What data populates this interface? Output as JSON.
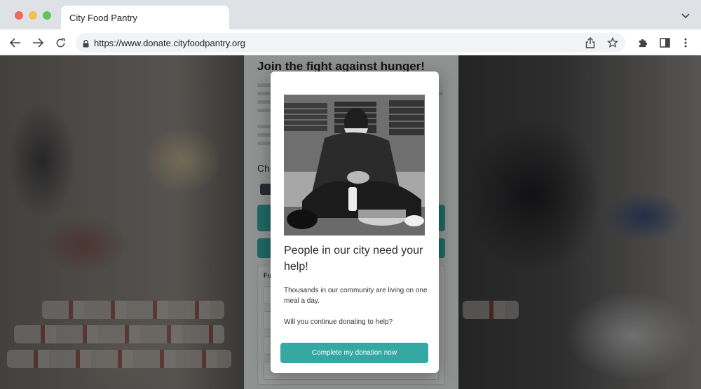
{
  "browser": {
    "tab_title": "City Food Pantry",
    "url": "https://www.donate.cityfoodpantry.org"
  },
  "page": {
    "heading": "Join the fight against hunger!",
    "choose_label_fragment": "Cho",
    "form_label_fragment": "Fu"
  },
  "modal": {
    "title": "People in our city need your help!",
    "body1": "Thousands in our community are living on one meal a day.",
    "body2": "Will you continue donating to help?",
    "cta_label": "Complete my donation now"
  },
  "colors": {
    "accent": "#35a8a4",
    "dot_red": "#ed6a5e",
    "dot_yellow": "#f5bf4f",
    "dot_green": "#61c554"
  }
}
